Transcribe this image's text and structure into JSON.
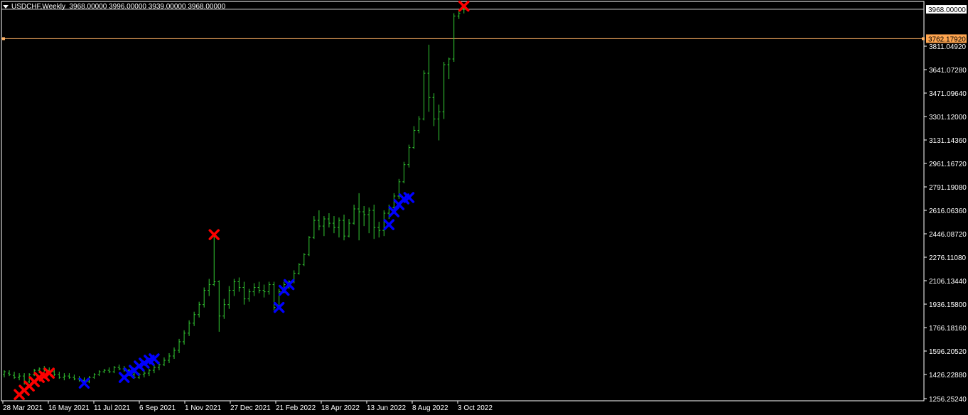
{
  "header": {
    "symbol_timeframe": "USDCHF,Weekly",
    "ohlc": "3968.00000 3996.00000 3939.00000 3968.00000"
  },
  "colors": {
    "background": "#000000",
    "candles": "#33cc33",
    "axis": "#ffffff",
    "sell_marker": "#ff0000",
    "buy_marker": "#0000ff",
    "current_price_line": "#c0c0c0",
    "level_line": "#ffb366",
    "level_label_bg": "#ffa54f"
  },
  "chart_data": {
    "type": "ohlc",
    "title": "",
    "xlabel": "",
    "ylabel": "",
    "ylim": [
      1226.5,
      4023.0
    ],
    "y_ticks": [
      "3811.04920",
      "3641.07280",
      "3471.09640",
      "3301.12000",
      "3131.14360",
      "2961.16720",
      "2791.19080",
      "2616.06360",
      "2446.08720",
      "2276.11080",
      "2106.13440",
      "1936.15800",
      "1766.18160",
      "1596.20520",
      "1426.22880",
      "1256.25240"
    ],
    "x_ticks": [
      "28 Mar 2021",
      "16 May 2021",
      "11 Jul 2021",
      "6 Sep 2021",
      "1 Nov 2021",
      "27 Dec 2021",
      "21 Feb 2022",
      "18 Apr 2022",
      "13 Jun 2022",
      "8 Aug 2022",
      "3 Oct 2022"
    ],
    "current_price": "3968.00000",
    "horizontal_level": "3762.17920",
    "bars": [
      [
        1410,
        1440,
        1390,
        1430
      ],
      [
        1420,
        1440,
        1400,
        1410
      ],
      [
        1405,
        1430,
        1380,
        1390
      ],
      [
        1390,
        1420,
        1370,
        1400
      ],
      [
        1400,
        1420,
        1340,
        1360
      ],
      [
        1360,
        1420,
        1350,
        1410
      ],
      [
        1410,
        1450,
        1400,
        1440
      ],
      [
        1440,
        1460,
        1420,
        1450
      ],
      [
        1450,
        1470,
        1430,
        1440
      ],
      [
        1440,
        1460,
        1420,
        1430
      ],
      [
        1430,
        1450,
        1400,
        1410
      ],
      [
        1410,
        1430,
        1380,
        1390
      ],
      [
        1390,
        1420,
        1370,
        1400
      ],
      [
        1400,
        1420,
        1380,
        1390
      ],
      [
        1390,
        1410,
        1370,
        1380
      ],
      [
        1380,
        1400,
        1360,
        1370
      ],
      [
        1370,
        1390,
        1350,
        1360
      ],
      [
        1360,
        1400,
        1350,
        1390
      ],
      [
        1390,
        1420,
        1380,
        1410
      ],
      [
        1410,
        1440,
        1400,
        1430
      ],
      [
        1430,
        1450,
        1420,
        1440
      ],
      [
        1440,
        1460,
        1420,
        1430
      ],
      [
        1430,
        1470,
        1420,
        1460
      ],
      [
        1460,
        1480,
        1440,
        1450
      ],
      [
        1450,
        1470,
        1430,
        1440
      ],
      [
        1440,
        1450,
        1400,
        1410
      ],
      [
        1410,
        1430,
        1380,
        1390
      ],
      [
        1390,
        1420,
        1380,
        1410
      ],
      [
        1410,
        1440,
        1390,
        1420
      ],
      [
        1420,
        1450,
        1400,
        1440
      ],
      [
        1440,
        1480,
        1420,
        1460
      ],
      [
        1460,
        1500,
        1440,
        1480
      ],
      [
        1480,
        1530,
        1470,
        1510
      ],
      [
        1510,
        1560,
        1490,
        1540
      ],
      [
        1540,
        1600,
        1520,
        1580
      ],
      [
        1580,
        1660,
        1560,
        1640
      ],
      [
        1640,
        1720,
        1620,
        1700
      ],
      [
        1700,
        1790,
        1680,
        1770
      ],
      [
        1770,
        1850,
        1750,
        1830
      ],
      [
        1830,
        1920,
        1810,
        1900
      ],
      [
        1900,
        2020,
        1880,
        2000
      ],
      [
        2000,
        2080,
        1960,
        2040
      ],
      [
        2040,
        2380,
        2030,
        2060
      ],
      [
        2060,
        2070,
        1710,
        1820
      ],
      [
        1820,
        1940,
        1800,
        1900
      ],
      [
        1900,
        2030,
        1870,
        2000
      ],
      [
        2000,
        2080,
        1960,
        2060
      ],
      [
        2060,
        2090,
        1990,
        2020
      ],
      [
        2020,
        2060,
        1900,
        1940
      ],
      [
        1940,
        2010,
        1920,
        1990
      ],
      [
        1990,
        2050,
        1960,
        2020
      ],
      [
        2020,
        2060,
        1980,
        2000
      ],
      [
        2000,
        2040,
        1950,
        1990
      ],
      [
        1990,
        2060,
        1970,
        2040
      ],
      [
        2040,
        2060,
        1860,
        1880
      ],
      [
        1880,
        2010,
        1870,
        1990
      ],
      [
        1990,
        2060,
        1980,
        2040
      ],
      [
        2040,
        2070,
        2010,
        2060
      ],
      [
        2060,
        2140,
        2050,
        2120
      ],
      [
        2120,
        2190,
        2110,
        2180
      ],
      [
        2180,
        2260,
        2170,
        2250
      ],
      [
        2250,
        2380,
        2240,
        2370
      ],
      [
        2370,
        2520,
        2360,
        2490
      ],
      [
        2490,
        2560,
        2420,
        2450
      ],
      [
        2450,
        2520,
        2380,
        2500
      ],
      [
        2500,
        2540,
        2440,
        2470
      ],
      [
        2470,
        2520,
        2400,
        2440
      ],
      [
        2440,
        2510,
        2370,
        2490
      ],
      [
        2490,
        2530,
        2350,
        2380
      ],
      [
        2380,
        2500,
        2370,
        2470
      ],
      [
        2470,
        2600,
        2460,
        2570
      ],
      [
        2570,
        2680,
        2350,
        2550
      ],
      [
        2550,
        2590,
        2450,
        2530
      ],
      [
        2530,
        2580,
        2400,
        2560
      ],
      [
        2560,
        2600,
        2360,
        2440
      ],
      [
        2440,
        2480,
        2370,
        2420
      ],
      [
        2420,
        2560,
        2380,
        2540
      ],
      [
        2540,
        2600,
        2500,
        2580
      ],
      [
        2580,
        2680,
        2550,
        2660
      ],
      [
        2660,
        2780,
        2640,
        2760
      ],
      [
        2760,
        2900,
        2750,
        2880
      ],
      [
        2880,
        3020,
        2860,
        3000
      ],
      [
        3000,
        3150,
        2990,
        3120
      ],
      [
        3120,
        3220,
        3100,
        3200
      ],
      [
        3200,
        3540,
        3190,
        3520
      ],
      [
        3520,
        3720,
        3250,
        3350
      ],
      [
        3350,
        3380,
        3150,
        3200
      ],
      [
        3200,
        3300,
        3050,
        3250
      ],
      [
        3250,
        3600,
        3200,
        3580
      ],
      [
        3580,
        3630,
        3480,
        3620
      ],
      [
        3620,
        3940,
        3600,
        3920
      ],
      [
        3920,
        3960,
        3900,
        3940
      ],
      [
        3968,
        3996,
        3939,
        3968
      ]
    ],
    "sell_signals": [
      {
        "bar": 3,
        "price": 1270
      },
      {
        "bar": 4,
        "price": 1300
      },
      {
        "bar": 5,
        "price": 1330
      },
      {
        "bar": 6,
        "price": 1360
      },
      {
        "bar": 7,
        "price": 1390
      },
      {
        "bar": 8,
        "price": 1400
      },
      {
        "bar": 9,
        "price": 1420
      },
      {
        "bar": 42,
        "price": 2390
      },
      {
        "bar": 92,
        "price": 3990
      }
    ],
    "buy_signals": [
      {
        "bar": 16,
        "price": 1350
      },
      {
        "bar": 24,
        "price": 1390
      },
      {
        "bar": 25,
        "price": 1420
      },
      {
        "bar": 26,
        "price": 1440
      },
      {
        "bar": 27,
        "price": 1470
      },
      {
        "bar": 28,
        "price": 1490
      },
      {
        "bar": 29,
        "price": 1510
      },
      {
        "bar": 30,
        "price": 1520
      },
      {
        "bar": 55,
        "price": 1880
      },
      {
        "bar": 56,
        "price": 2000
      },
      {
        "bar": 57,
        "price": 2040
      },
      {
        "bar": 77,
        "price": 2460
      },
      {
        "bar": 78,
        "price": 2550
      },
      {
        "bar": 79,
        "price": 2600
      },
      {
        "bar": 80,
        "price": 2640
      },
      {
        "bar": 81,
        "price": 2650
      }
    ]
  }
}
